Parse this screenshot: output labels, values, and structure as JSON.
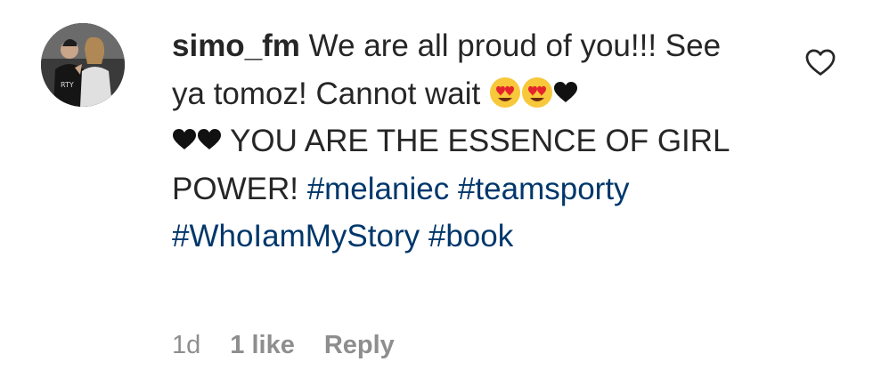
{
  "comment": {
    "username": "simo_fm",
    "text_parts": [
      " We are all proud of you!!! See ya tomoz! Cannot wait ",
      " YOU ARE THE ESSENCE OF GIRL POWER! "
    ],
    "hashtags": [
      "#melaniec",
      "#teamsporty",
      "#WhoIamMyStory",
      "#book"
    ],
    "emoji": [
      "heart-eyes-face-emoji",
      "heart-eyes-face-emoji",
      "black-heart",
      "black-heart",
      "black-heart"
    ]
  },
  "meta": {
    "time": "1d",
    "likes": "1 like",
    "reply_label": "Reply"
  },
  "icons": {
    "like": "heart-outline-icon"
  },
  "colors": {
    "text": "#262626",
    "hashtag": "#00376b",
    "meta": "#8e8e8e"
  }
}
